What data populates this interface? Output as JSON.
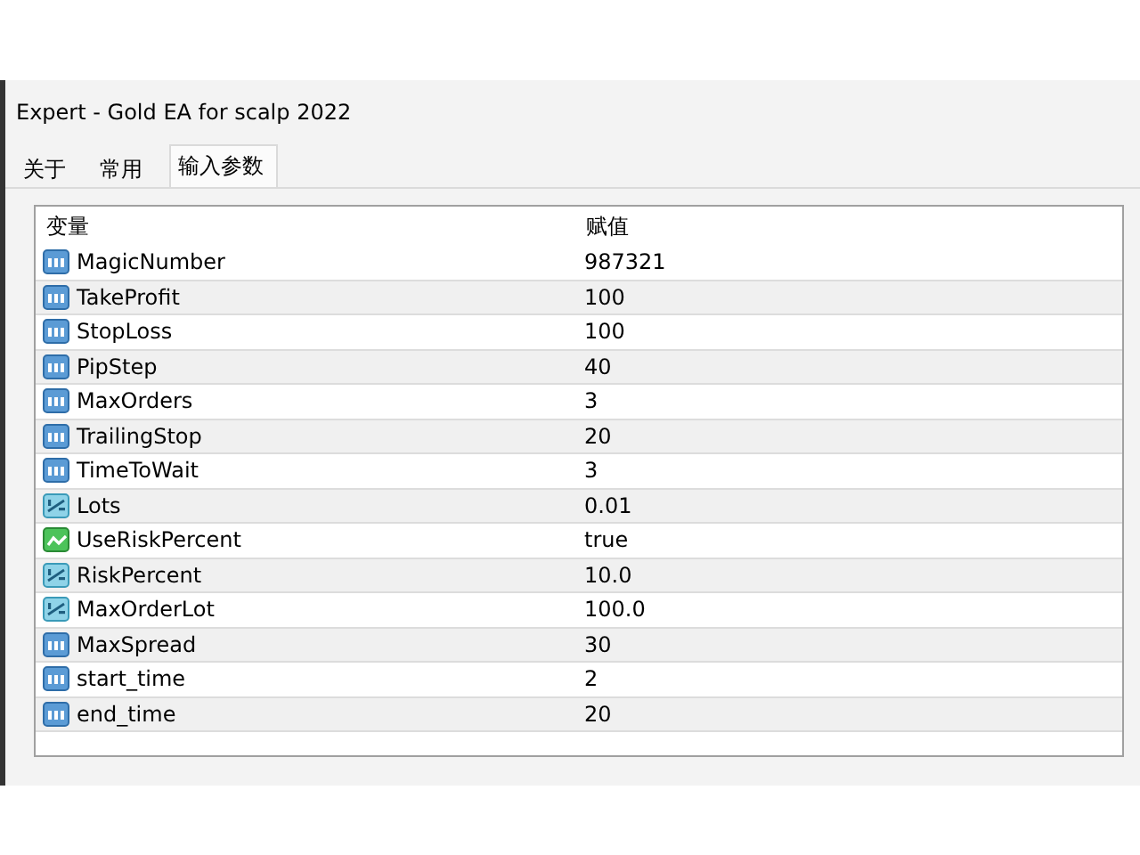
{
  "window": {
    "title": "Expert - Gold EA for scalp 2022"
  },
  "tabs": [
    {
      "label": "关于",
      "selected": false
    },
    {
      "label": "常用",
      "selected": false
    },
    {
      "label": "输入参数",
      "selected": true
    }
  ],
  "table": {
    "columns": [
      "变量",
      "赋值"
    ],
    "rows": [
      {
        "kind": "int",
        "name": "MagicNumber",
        "value": "987321"
      },
      {
        "kind": "int",
        "name": "TakeProfit",
        "value": "100"
      },
      {
        "kind": "int",
        "name": "StopLoss",
        "value": "100"
      },
      {
        "kind": "int",
        "name": "PipStep",
        "value": "40"
      },
      {
        "kind": "int",
        "name": "MaxOrders",
        "value": "3"
      },
      {
        "kind": "int",
        "name": "TrailingStop",
        "value": "20"
      },
      {
        "kind": "int",
        "name": "TimeToWait",
        "value": "3"
      },
      {
        "kind": "double",
        "name": "Lots",
        "value": "0.01"
      },
      {
        "kind": "bool",
        "name": "UseRiskPercent",
        "value": "true"
      },
      {
        "kind": "double",
        "name": "RiskPercent",
        "value": "10.0"
      },
      {
        "kind": "double",
        "name": "MaxOrderLot",
        "value": "100.0"
      },
      {
        "kind": "int",
        "name": "MaxSpread",
        "value": "30"
      },
      {
        "kind": "int",
        "name": "start_time",
        "value": "2"
      },
      {
        "kind": "int",
        "name": "end_time",
        "value": "20"
      }
    ]
  }
}
